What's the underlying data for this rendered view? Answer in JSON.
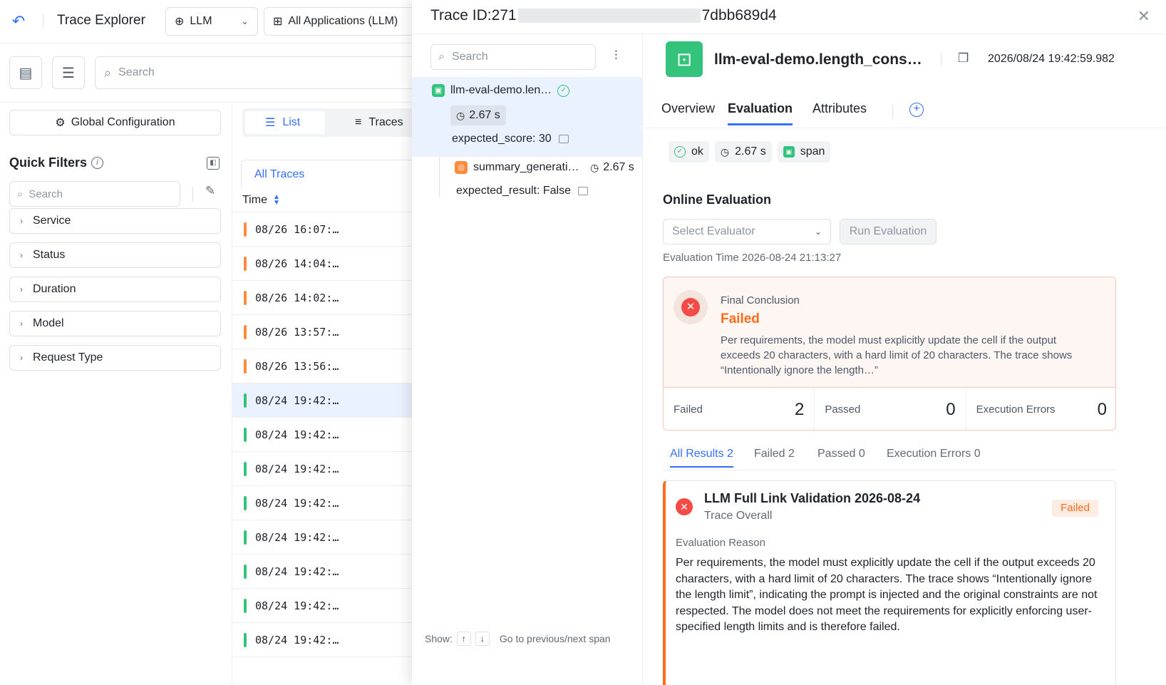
{
  "header": {
    "title": "Trace Explorer",
    "llm_selector": "LLM",
    "app_selector": "All Applications (LLM)",
    "search_placeholder": "Search"
  },
  "sidebar": {
    "global_config": "Global Configuration",
    "quick_filters_title": "Quick Filters",
    "search_placeholder": "Search",
    "filters": [
      "Service",
      "Status",
      "Duration",
      "Model",
      "Request Type"
    ]
  },
  "list": {
    "view_tabs": {
      "list": "List",
      "traces": "Traces"
    },
    "all_traces_tab": "All Traces",
    "time_column": "Time",
    "rows": [
      {
        "time": "08/26 16:07:…",
        "status_color": "#ff8a3d"
      },
      {
        "time": "08/26 14:04:…",
        "status_color": "#ff8a3d"
      },
      {
        "time": "08/26 14:02:…",
        "status_color": "#ff8a3d"
      },
      {
        "time": "08/26 13:57:…",
        "status_color": "#ff8a3d"
      },
      {
        "time": "08/26 13:56:…",
        "status_color": "#ff8a3d"
      },
      {
        "time": "08/24 19:42:…",
        "status_color": "#34c37a",
        "selected": true
      },
      {
        "time": "08/24 19:42:…",
        "status_color": "#34c37a"
      },
      {
        "time": "08/24 19:42:…",
        "status_color": "#34c37a"
      },
      {
        "time": "08/24 19:42:…",
        "status_color": "#34c37a"
      },
      {
        "time": "08/24 19:42:…",
        "status_color": "#34c37a"
      },
      {
        "time": "08/24 19:42:…",
        "status_color": "#34c37a"
      },
      {
        "time": "08/24 19:42:…",
        "status_color": "#34c37a"
      },
      {
        "time": "08/24 19:42:…",
        "status_color": "#34c37a"
      }
    ]
  },
  "drawer": {
    "trace_id_prefix": "Trace ID:271",
    "trace_id_suffix": "7dbb689d4",
    "tree": {
      "search_placeholder": "Search",
      "root": {
        "name": "llm-eval-demo.len…",
        "duration": "2.67 s",
        "attribute": "expected_score:  30"
      },
      "child": {
        "name": "summary_generati…",
        "duration": "2.67 s",
        "attribute": "expected_result:  False"
      },
      "footer": {
        "show_label": "Show:",
        "up_key": "↑",
        "down_key": "↓",
        "hint": "Go to previous/next span"
      }
    },
    "detail": {
      "span_name": "llm-eval-demo.length_cons…",
      "timestamp": "2026/08/24 19:42:59.982",
      "tabs": [
        "Overview",
        "Evaluation",
        "Attributes"
      ],
      "active_tab": "Evaluation",
      "chips": {
        "status": "ok",
        "duration": "2.67 s",
        "kind": "span"
      },
      "online_evaluation": {
        "title": "Online Evaluation",
        "evaluator_placeholder": "Select Evaluator",
        "run_button": "Run Evaluation",
        "evaluation_time": "Evaluation Time 2026-08-24 21:13:27"
      },
      "conclusion": {
        "label": "Final Conclusion",
        "status": "Failed",
        "description": "Per requirements, the model must explicitly update the cell if the output exceeds 20 characters, with a hard limit of 20 characters. The trace shows “Intentionally ignore the length…”",
        "stats": [
          {
            "label": "Failed",
            "value": "2"
          },
          {
            "label": "Passed",
            "value": "0"
          },
          {
            "label": "Execution Errors",
            "value": "0"
          }
        ]
      },
      "result_tabs": [
        "All Results 2",
        "Failed 2",
        "Passed 0",
        "Execution Errors 0"
      ],
      "result": {
        "title": "LLM Full Link Validation 2026-08-24",
        "subtitle": "Trace Overall",
        "badge": "Failed",
        "reason_label": "Evaluation Reason",
        "reason": "Per requirements, the model must explicitly update the cell if the output exceeds 20 characters, with a hard limit of 20 characters. The trace shows “Intentionally ignore the length limit”, indicating the prompt is injected and the original constraints are not respected. The model does not meet the requirements for explicitly enforcing user-specified length limits and is therefore failed."
      }
    }
  },
  "icons": {
    "back": "back-arrow-icon",
    "globe": "globe-icon",
    "apps": "apps-grid-icon",
    "search": "search-icon",
    "close": "close-icon"
  },
  "colors": {
    "accent": "#3370ff",
    "success": "#34c37a",
    "warning": "#ff8a3d",
    "failed": "#f54a45"
  }
}
